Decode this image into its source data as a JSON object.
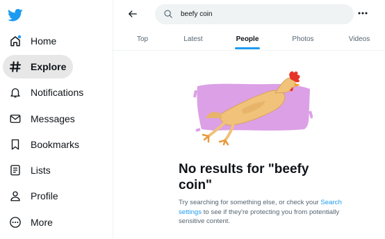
{
  "sidebar": {
    "items": [
      {
        "label": "Home",
        "icon": "home-icon"
      },
      {
        "label": "Explore",
        "icon": "hashtag-icon"
      },
      {
        "label": "Notifications",
        "icon": "bell-icon"
      },
      {
        "label": "Messages",
        "icon": "envelope-icon"
      },
      {
        "label": "Bookmarks",
        "icon": "bookmark-icon"
      },
      {
        "label": "Lists",
        "icon": "list-icon"
      },
      {
        "label": "Profile",
        "icon": "person-icon"
      },
      {
        "label": "More",
        "icon": "more-circle-icon"
      }
    ],
    "active": "Explore"
  },
  "search": {
    "value": "beefy coin"
  },
  "tabs": [
    {
      "label": "Top"
    },
    {
      "label": "Latest"
    },
    {
      "label": "People"
    },
    {
      "label": "Photos"
    },
    {
      "label": "Videos"
    }
  ],
  "active_tab": "People",
  "empty_state": {
    "title": "No results for \"beefy coin\"",
    "text_before": "Try searching for something else, or check your",
    "link": "Search settings",
    "text_after": "to see if they're protecting you from potentially sensitive content."
  },
  "colors": {
    "brand": "#1d9bf0",
    "active_bg": "#e7e7e8",
    "illustration_bg": "#dca0e6"
  }
}
